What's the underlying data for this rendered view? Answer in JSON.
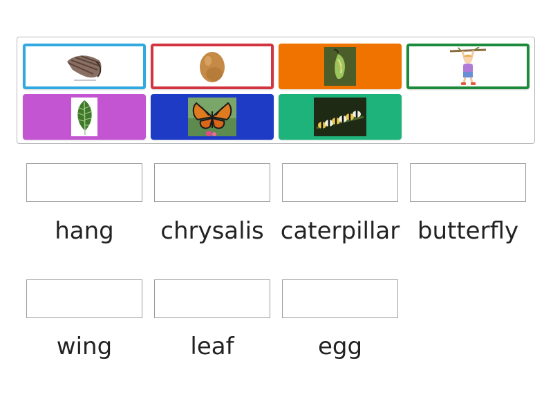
{
  "tiles": [
    {
      "icon": "wing-icon",
      "color": "#31a9e0",
      "style": "outlined"
    },
    {
      "icon": "egg-icon",
      "color": "#d2353f",
      "style": "outlined"
    },
    {
      "icon": "chrysalis-icon",
      "color": "#f07300",
      "style": "filled"
    },
    {
      "icon": "hanging-child-icon",
      "color": "#1b8a3a",
      "style": "outlined"
    },
    {
      "icon": "leaf-icon",
      "color": "#c455d2",
      "style": "filled"
    },
    {
      "icon": "butterfly-icon",
      "color": "#1e3bc6",
      "style": "filled"
    },
    {
      "icon": "caterpillar-icon",
      "color": "#1fb37c",
      "style": "filled"
    }
  ],
  "targets": [
    {
      "label": "hang"
    },
    {
      "label": "chrysalis"
    },
    {
      "label": "caterpillar"
    },
    {
      "label": "butterfly"
    },
    {
      "label": "wing"
    },
    {
      "label": "leaf"
    },
    {
      "label": "egg"
    }
  ]
}
